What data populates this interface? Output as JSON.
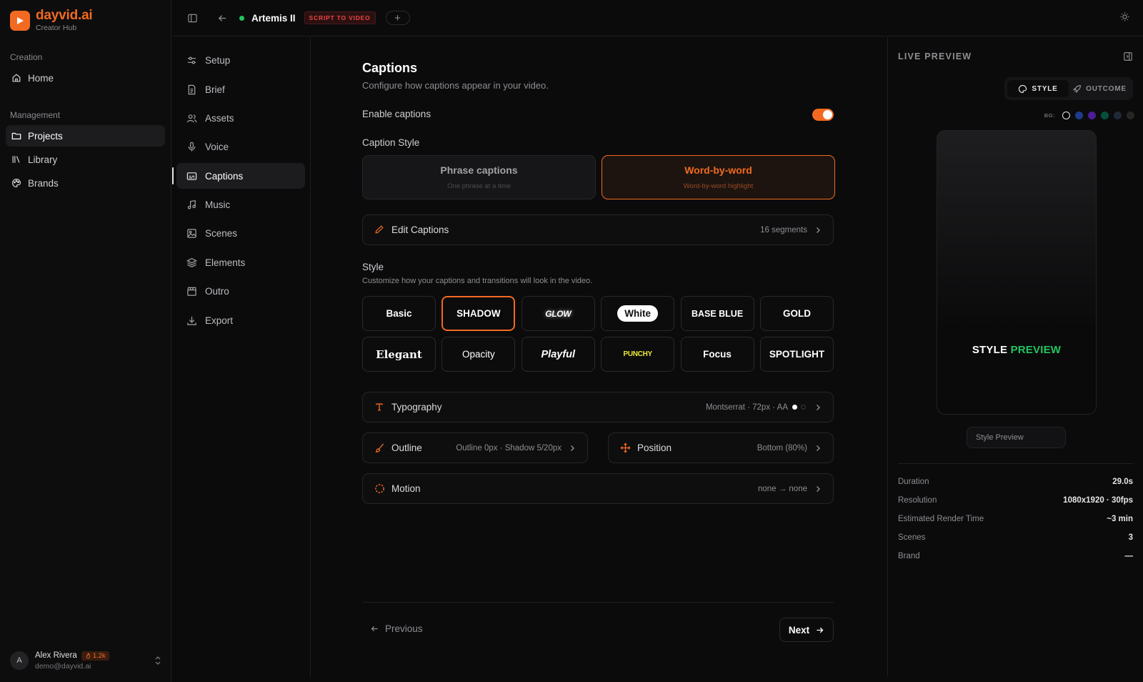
{
  "brand": {
    "name": "dayvid.ai",
    "subtitle": "Creator Hub"
  },
  "sidebar": {
    "section_creation": "Creation",
    "section_management": "Management",
    "items": [
      {
        "label": "Home",
        "icon": "home-icon"
      },
      {
        "label": "Projects",
        "icon": "folder-icon"
      },
      {
        "label": "Library",
        "icon": "library-icon"
      },
      {
        "label": "Brands",
        "icon": "palette-icon"
      }
    ],
    "user": {
      "initial": "A",
      "name": "Alex Rivera",
      "credits": "1.2k",
      "email": "demo@dayvid.ai"
    }
  },
  "topbar": {
    "project_name": "Artemis II",
    "tag": "SCRIPT TO VIDEO",
    "add_label": "+"
  },
  "steps": [
    {
      "label": "Setup",
      "icon": "sliders-icon"
    },
    {
      "label": "Brief",
      "icon": "document-icon"
    },
    {
      "label": "Assets",
      "icon": "users-icon"
    },
    {
      "label": "Voice",
      "icon": "microphone-icon"
    },
    {
      "label": "Captions",
      "icon": "captions-icon"
    },
    {
      "label": "Music",
      "icon": "music-icon"
    },
    {
      "label": "Scenes",
      "icon": "image-icon"
    },
    {
      "label": "Elements",
      "icon": "layers-icon"
    },
    {
      "label": "Outro",
      "icon": "clapper-icon"
    },
    {
      "label": "Export",
      "icon": "download-icon"
    }
  ],
  "main": {
    "title": "Captions",
    "subtitle": "Configure how captions appear in your video.",
    "enable_label": "Enable captions",
    "enable_on": true,
    "caption_style_label": "Caption Style",
    "caption_styles": [
      {
        "title": "Phrase captions",
        "sub": "One phrase at a time",
        "selected": false
      },
      {
        "title": "Word-by-word",
        "sub": "Word-by-word highlight",
        "selected": true
      }
    ],
    "edit_captions": {
      "label": "Edit Captions",
      "value": "16 segments"
    },
    "style_label": "Style",
    "style_sub": "Customize how your captions and transitions will look in the video.",
    "styles": [
      "Basic",
      "SHADOW",
      "GLOW",
      "White",
      "BASE BLUE",
      "GOLD",
      "Elegant",
      "Opacity",
      "Playful",
      "PUNCHY",
      "Focus",
      "SPOTLIGHT"
    ],
    "selected_style": "SHADOW",
    "typography": {
      "label": "Typography",
      "value": "Montserrat · 72px · AA"
    },
    "outline": {
      "label": "Outline",
      "value": "Outline 0px · Shadow 5/20px"
    },
    "position": {
      "label": "Position",
      "value": "Bottom (80%)"
    },
    "motion": {
      "label": "Motion",
      "value": "none → none"
    },
    "prev_label": "Previous",
    "next_label": "Next"
  },
  "preview": {
    "title": "LIVE PREVIEW",
    "tabs": [
      "STYLE",
      "OUTCOME"
    ],
    "active_tab": "STYLE",
    "bg_label": "BG:",
    "bg_colors": [
      "#000000",
      "#1e3a8a",
      "#4c1d95",
      "#064e3b",
      "#1f2937",
      "#262626"
    ],
    "caption_word1": "STYLE",
    "caption_word2": "PREVIEW",
    "input_value": "Style Preview",
    "info": [
      {
        "k": "Duration",
        "v": "29.0s"
      },
      {
        "k": "Resolution",
        "v": "1080x1920 · 30fps"
      },
      {
        "k": "Estimated Render Time",
        "v": "~3 min"
      },
      {
        "k": "Scenes",
        "v": "3"
      },
      {
        "k": "Brand",
        "v": "—"
      }
    ]
  },
  "colors": {
    "accent": "#f26a21",
    "highlight": "#22c55e",
    "status": "#22c55e",
    "tag": "#ef4444",
    "punchy": "#e8e83a"
  }
}
